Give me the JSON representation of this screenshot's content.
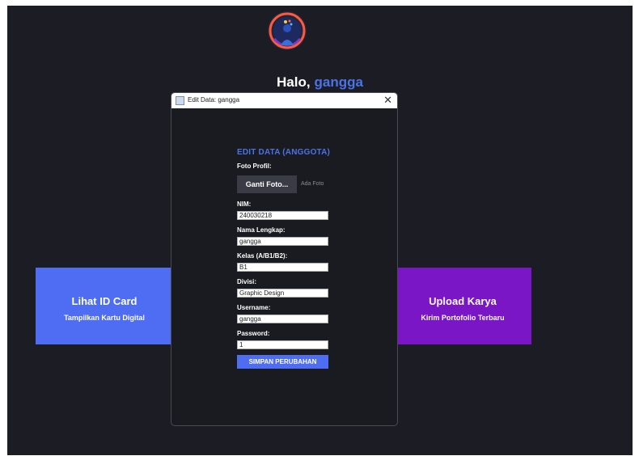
{
  "main": {
    "greeting_prefix": "Halo,",
    "username": "gangga"
  },
  "cards": {
    "left": {
      "title": "Lihat ID Card",
      "subtitle": "Tampilkan Kartu Digital",
      "color": "#4e6df2"
    },
    "right": {
      "title": "Upload Karya",
      "subtitle": "Kirim Portofolio Terbaru",
      "color": "#7a16c6"
    }
  },
  "dialog": {
    "window_title": "Edit Data: gangga",
    "close_glyph": "✕",
    "heading": "EDIT DATA (ANGGOTA)",
    "photo": {
      "label": "Foto Profil:",
      "button": "Ganti Foto...",
      "status": "Ada Foto"
    },
    "fields": {
      "nim": {
        "label": "NIM:",
        "value": "240030218"
      },
      "nama": {
        "label": "Nama Lengkap:",
        "value": "gangga"
      },
      "kelas": {
        "label": "Kelas (A/B1/B2):",
        "value": "B1"
      },
      "divisi": {
        "label": "Divisi:",
        "value": "Graphic Design"
      },
      "username": {
        "label": "Username:",
        "value": "gangga"
      },
      "password": {
        "label": "Password:",
        "value": "1"
      }
    },
    "save_button": "SIMPAN PERUBAHAN"
  },
  "colors": {
    "background": "#1c1d24",
    "accent": "#4a73e8"
  },
  "icons": {
    "logo": "ai-figure-logo",
    "window": "app-window-icon",
    "close": "close-icon"
  }
}
